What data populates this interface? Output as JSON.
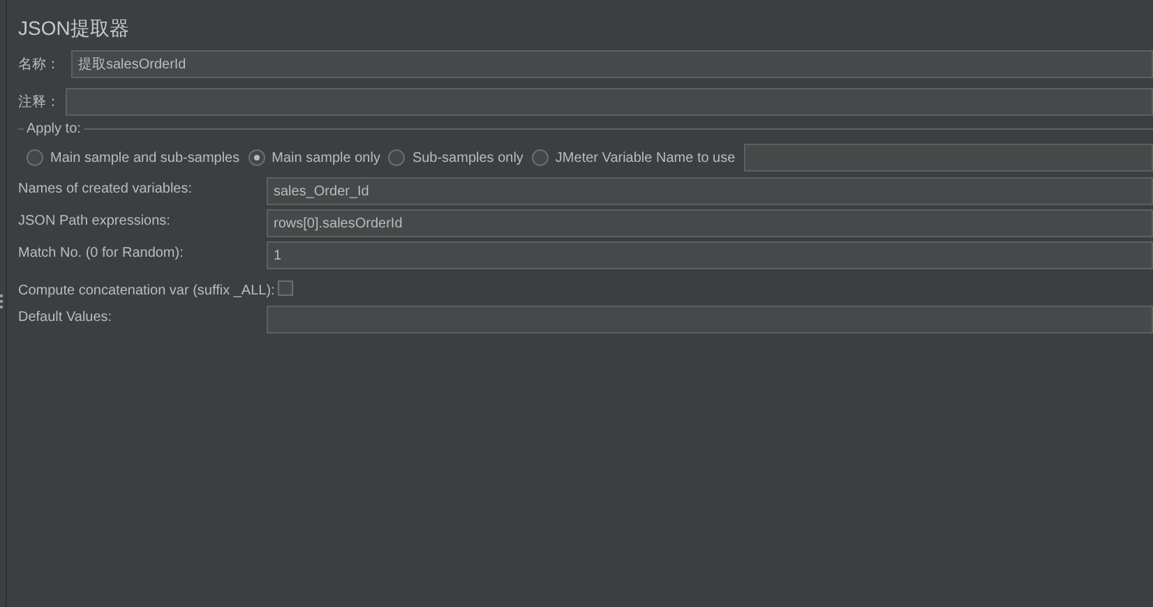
{
  "title": "JSON提取器",
  "name": {
    "label": "名称：",
    "value": "提取salesOrderId"
  },
  "comment": {
    "label": "注释："
  },
  "apply_to": {
    "legend": "Apply to:",
    "options": [
      {
        "label": "Main sample and sub-samples",
        "selected": false
      },
      {
        "label": "Main sample only",
        "selected": true
      },
      {
        "label": "Sub-samples only",
        "selected": false
      },
      {
        "label": "JMeter Variable Name to use",
        "selected": false
      }
    ]
  },
  "fields": [
    {
      "kind": "text",
      "label": "Names of created variables:",
      "value": "sales_Order_Id"
    },
    {
      "kind": "text",
      "label": "JSON Path expressions:",
      "value": "rows[0].salesOrderId"
    },
    {
      "kind": "text",
      "label": "Match No. (0 for Random):",
      "value": "1"
    },
    {
      "kind": "checkbox",
      "label": "Compute concatenation var (suffix _ALL):",
      "checked": false
    },
    {
      "kind": "text",
      "label": "Default Values:"
    }
  ]
}
